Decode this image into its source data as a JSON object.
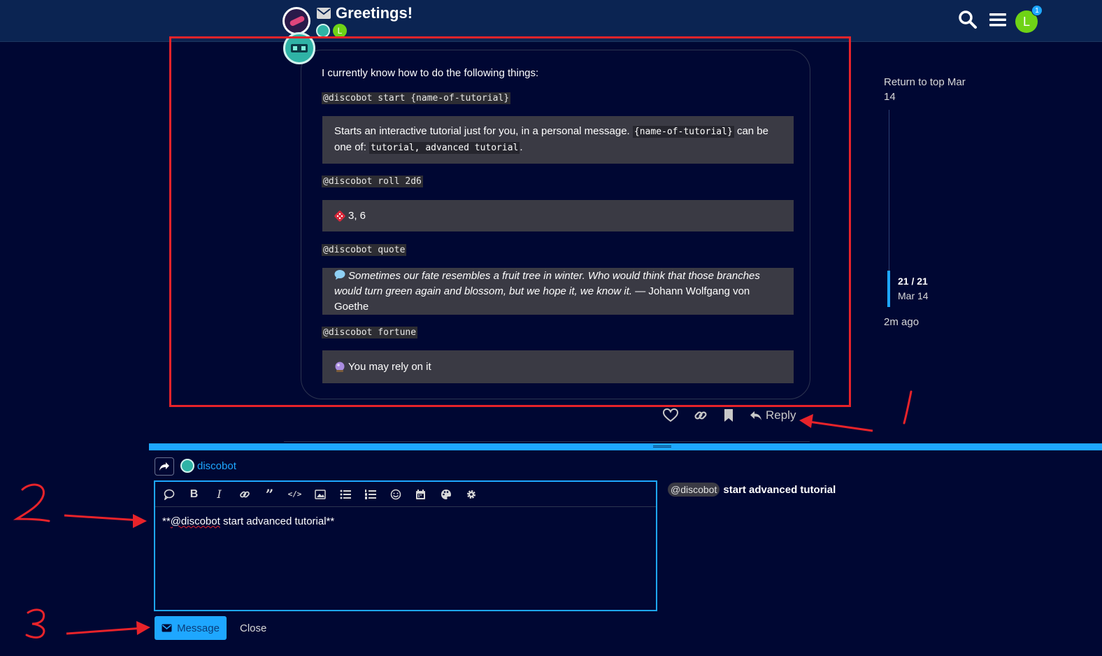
{
  "header": {
    "title": "Greetings!",
    "avatar_initial": "L",
    "notification_count": "1"
  },
  "post": {
    "intro": "I currently know how to do the following things:",
    "commands": [
      {
        "command": "@discobot start {name-of-tutorial}",
        "result_pre": "Starts an interactive tutorial just for you, in a personal message.",
        "result_code": "{name-of-tutorial}",
        "result_mid": "can be",
        "result_line2_pre": "one of:",
        "result_line2_code": "tutorial, advanced tutorial",
        "result_line2_post": "."
      },
      {
        "command": "@discobot roll 2d6",
        "result": "3, 6",
        "icon": "dice-icon"
      },
      {
        "command": "@discobot quote",
        "quote_line1": "Sometimes our fate resembles a fruit tree in winter. Who would think that those branches",
        "quote_line2": "would turn green again and blossom, but we hope it, we know it.",
        "attribution": "— Johann Wolfgang von Goethe",
        "icon": "speech-bubble-icon"
      },
      {
        "command": "@discobot fortune",
        "result": "You may rely on it",
        "icon": "crystal-ball-icon"
      }
    ],
    "reply_label": "Reply"
  },
  "timeline": {
    "return_to_top": "Return to top",
    "start_date": "Mar 14",
    "position": "21 / 21",
    "position_date": "Mar 14",
    "last_activity": "2m ago"
  },
  "composer": {
    "recipient": "discobot",
    "editor_prefix": "**",
    "editor_mention": "@discobot",
    "editor_rest": " start advanced tutorial**",
    "preview_mention": "@discobot",
    "preview_text": "start advanced tutorial",
    "send_label": "Message",
    "close_label": "Close"
  },
  "colors": {
    "background": "#000733",
    "header": "#0b2452",
    "accent": "#1ea7ff",
    "annotation_red": "#e8232a"
  }
}
